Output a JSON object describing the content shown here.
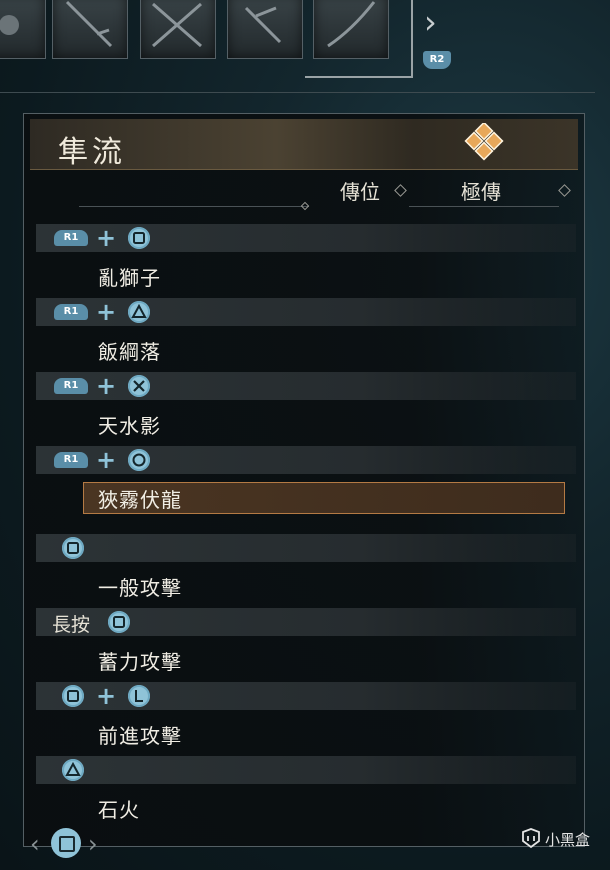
{
  "top_bar": {
    "next_label": "R2"
  },
  "panel": {
    "title": "隼流",
    "col_1": "傳位",
    "col_2": "極傳"
  },
  "rows": [
    {
      "trigger": "R1",
      "button": "square-icon",
      "move": "亂獅子"
    },
    {
      "trigger": "R1",
      "button": "triangle-icon",
      "move": "飯綱落"
    },
    {
      "trigger": "R1",
      "button": "cross-icon",
      "move": "天水影"
    },
    {
      "trigger": "R1",
      "button": "circle-icon",
      "move": "狹霧伏龍",
      "selected": true
    },
    {
      "button": "square-icon",
      "move": "一般攻擊"
    },
    {
      "prefix": "長按",
      "button": "square-icon",
      "move": "蓄力攻擊"
    },
    {
      "button": "square-icon",
      "second": "left-stick-icon",
      "move": "前進攻擊"
    },
    {
      "button": "triangle-icon",
      "move": "石火"
    }
  ],
  "watermark": "小黑盒",
  "colors": {
    "accent_blue": "#8fc3d8",
    "highlight_border": "#b47a44",
    "header_gold": "#4b4232"
  }
}
